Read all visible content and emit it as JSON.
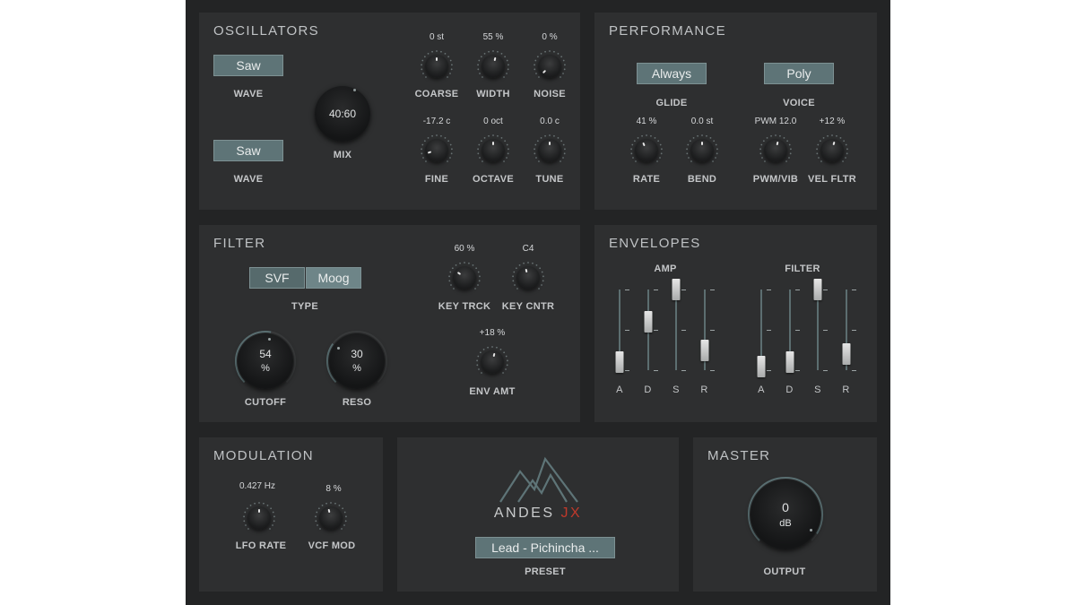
{
  "oscillators": {
    "title": "OSCILLATORS",
    "wave1": {
      "value": "Saw",
      "label": "WAVE"
    },
    "wave2": {
      "value": "Saw",
      "label": "WAVE"
    },
    "mix": {
      "value": "40:60",
      "label": "MIX"
    },
    "coarse": {
      "value": "0 st",
      "label": "COARSE",
      "level": 0.5
    },
    "width": {
      "value": "55 %",
      "label": "WIDTH",
      "level": 0.55
    },
    "noise": {
      "value": "0 %",
      "label": "NOISE",
      "level": 0.0
    },
    "fine": {
      "value": "-17.2 c",
      "label": "FINE",
      "level": 0.1
    },
    "octave": {
      "value": "0 oct",
      "label": "OCTAVE",
      "level": 0.5
    },
    "tune": {
      "value": "0.0 c",
      "label": "TUNE",
      "level": 0.5
    }
  },
  "performance": {
    "title": "PERFORMANCE",
    "glide": {
      "value": "Always",
      "label": "GLIDE"
    },
    "voice": {
      "value": "Poly",
      "label": "VOICE"
    },
    "rate": {
      "value": "41 %",
      "label": "RATE",
      "level": 0.41
    },
    "bend": {
      "value": "0.0 st",
      "label": "BEND",
      "level": 0.5
    },
    "pwmvib": {
      "value": "PWM 12.0",
      "label": "PWM/VIB",
      "level": 0.55
    },
    "velfltr": {
      "value": "+12 %",
      "label": "VEL FLTR",
      "level": 0.56
    }
  },
  "filter": {
    "title": "FILTER",
    "type_options": [
      "SVF",
      "Moog"
    ],
    "type_selected": "Moog",
    "type_label": "TYPE",
    "cutoff": {
      "value": "54",
      "unit": "%",
      "label": "CUTOFF",
      "level": 0.54
    },
    "reso": {
      "value": "30",
      "unit": "%",
      "label": "RESO",
      "level": 0.3
    },
    "keytrck": {
      "value": "60 %",
      "label": "KEY TRCK",
      "level": 0.3
    },
    "keycntr": {
      "value": "C4",
      "label": "KEY CNTR",
      "level": 0.45
    },
    "envamt": {
      "value": "+18 %",
      "label": "ENV AMT",
      "level": 0.55
    }
  },
  "envelopes": {
    "title": "ENVELOPES",
    "amp": {
      "label": "AMP",
      "a": 0.1,
      "d": 0.6,
      "s": 1.0,
      "r": 0.25
    },
    "filter": {
      "label": "FILTER",
      "a": 0.05,
      "d": 0.1,
      "s": 1.0,
      "r": 0.2
    },
    "letters": [
      "A",
      "D",
      "S",
      "R"
    ]
  },
  "modulation": {
    "title": "MODULATION",
    "lforate": {
      "value": "0.427 Hz",
      "label": "LFO RATE",
      "level": 0.5
    },
    "vcfmod": {
      "value": "8 %",
      "label": "VCF MOD",
      "level": 0.45
    }
  },
  "brand": {
    "name": "ANDES",
    "suffix": "JX",
    "suffix_color": "#c0392b",
    "logo_color": "#5e7477"
  },
  "preset": {
    "value": "Lead - Pichincha ...",
    "label": "PRESET"
  },
  "master": {
    "title": "MASTER",
    "output": {
      "value": "0",
      "unit": "dB",
      "label": "OUTPUT",
      "level": 0.95
    }
  },
  "colors": {
    "panel": "#2e2f30",
    "background": "#232425",
    "accent": "#5e7477"
  }
}
